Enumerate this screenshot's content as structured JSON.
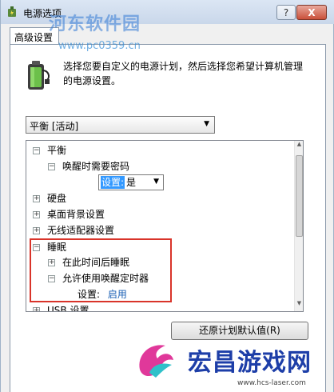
{
  "window": {
    "title": "电源选项",
    "help_label": "?",
    "close_label": "X"
  },
  "tab": {
    "label": "高级设置"
  },
  "description": "选择您要自定义的电源计划，然后选择您希望计算机管理的电源设置。",
  "plan_select": {
    "value": "平衡 [活动]"
  },
  "tree": {
    "items": [
      {
        "expander": "−",
        "label": "平衡"
      },
      {
        "expander": "−",
        "label": "唤醒时需要密码"
      },
      {
        "expander": "+",
        "label": "硬盘"
      },
      {
        "expander": "+",
        "label": "桌面背景设置"
      },
      {
        "expander": "+",
        "label": "无线适配器设置"
      },
      {
        "expander": "−",
        "label": "睡眠"
      },
      {
        "expander": "+",
        "label": "在此时间后睡眠"
      },
      {
        "expander": "−",
        "label": "允许使用唤醒定时器"
      },
      {
        "expander": "+",
        "label": "USB 设置"
      }
    ],
    "password_setting": {
      "label": "设置:",
      "value": "是"
    },
    "timer_setting": {
      "label": "设置:",
      "value": "启用"
    }
  },
  "restore_button": {
    "label": "还原计划默认值(R)"
  },
  "watermarks": {
    "top_text": "河东软件园",
    "top_url": "www.pc0359.cn",
    "brand": "宏昌游戏网",
    "site": "www.hcs-laser.com"
  },
  "colors": {
    "highlight_border": "#d9342a",
    "selection": "#3399ff",
    "link_value": "#1a5fb4"
  }
}
